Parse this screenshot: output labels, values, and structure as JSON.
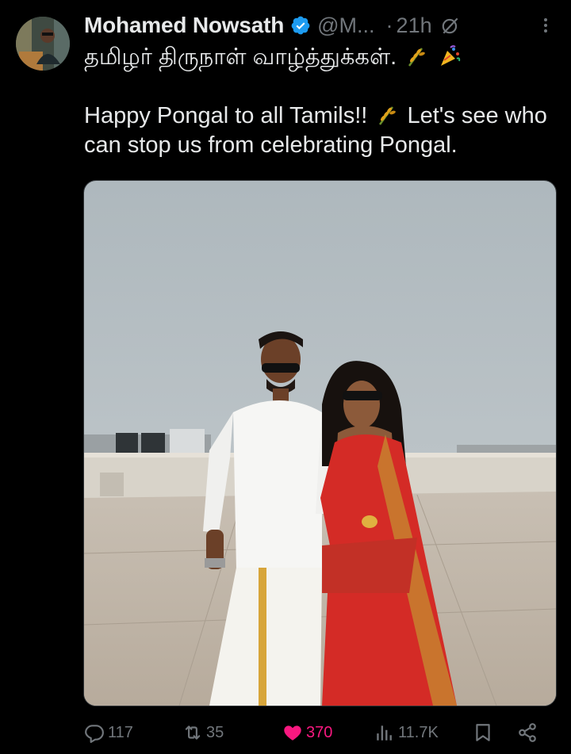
{
  "author": {
    "name": "Mohamed Nowsath",
    "handle": "@M...",
    "separator": "·",
    "time": "21h"
  },
  "tweet": {
    "line1": "தமிழர் திருநாள் வாழ்த்துக்கள்.",
    "line2_a": "Happy Pongal to all Tamils!!",
    "line2_b": "Let's see who can stop us from celebrating Pongal."
  },
  "icons": {
    "verified": "verified-badge-icon",
    "grok": "grok-icon",
    "more": "more-vertical-icon",
    "reply": "reply-icon",
    "repost": "repost-icon",
    "like": "heart-icon",
    "views": "views-icon",
    "bookmark": "bookmark-icon",
    "share": "share-icon"
  },
  "actions": {
    "replies": "117",
    "reposts": "35",
    "likes": "370",
    "views": "11.7K"
  },
  "colors": {
    "background": "#000000",
    "text": "#e7e9ea",
    "muted": "#71767b",
    "verified": "#1d9bf0",
    "like": "#f91880"
  }
}
